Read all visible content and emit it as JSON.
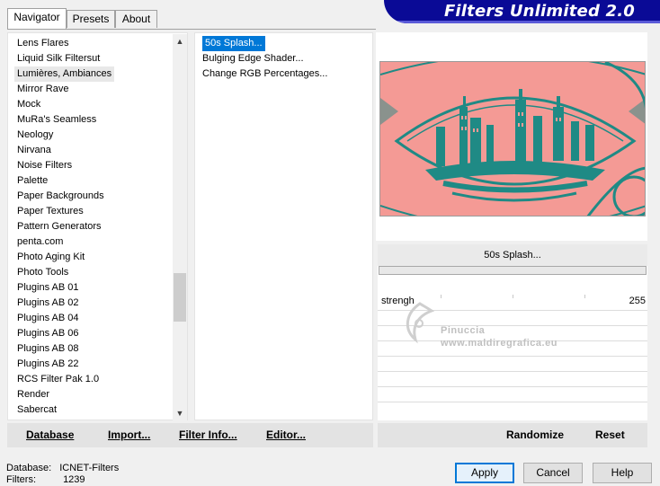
{
  "tabs": [
    {
      "label": "Navigator",
      "active": true
    },
    {
      "label": "Presets",
      "active": false
    },
    {
      "label": "About",
      "active": false
    }
  ],
  "banner": {
    "title": "Filters Unlimited 2.0"
  },
  "categories": {
    "items": [
      "Lens Flares",
      "Liquid Silk Filtersut",
      "Lumières, Ambiances",
      "Mirror Rave",
      "Mock",
      "MuRa's Seamless",
      "Neology",
      "Nirvana",
      "Noise Filters",
      "Palette",
      "Paper Backgrounds",
      "Paper Textures",
      "Pattern Generators",
      "penta.com",
      "Photo Aging Kit",
      "Photo Tools",
      "Plugins AB 01",
      "Plugins AB 02",
      "Plugins AB 04",
      "Plugins AB 06",
      "Plugins AB 08",
      "Plugins AB 22",
      "RCS Filter Pak 1.0",
      "Render",
      "Sabercat"
    ],
    "selected_index": 2
  },
  "filters": {
    "items": [
      "50s Splash...",
      "Bulging Edge Shader...",
      "Change RGB Percentages..."
    ],
    "selected_index": 0
  },
  "controls": {
    "filter_name": "50s Splash...",
    "slider_label": "strengh",
    "slider_value": "255"
  },
  "watermark": {
    "line1": "Pinuccia",
    "line2": "www.maldiregrafica.eu"
  },
  "toolbar": {
    "database_label": "Database",
    "import_label": "Import...",
    "filter_info_label": "Filter Info...",
    "editor_label": "Editor...",
    "randomize_label": "Randomize",
    "reset_label": "Reset"
  },
  "status": {
    "database_label": "Database:",
    "database_value": "ICNET-Filters",
    "filters_label": "Filters:",
    "filters_value": "1239"
  },
  "buttons": {
    "apply": "Apply",
    "cancel": "Cancel",
    "help": "Help"
  },
  "colors": {
    "preview_bg": "#f49a95",
    "preview_ink": "#1f8a85",
    "banner": "#0a0a96",
    "selection": "#0078d7"
  }
}
